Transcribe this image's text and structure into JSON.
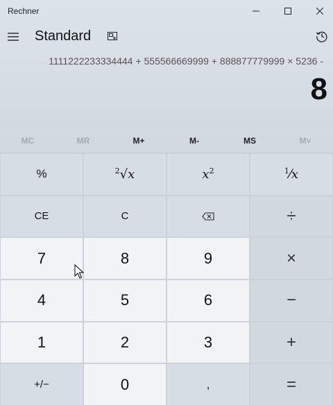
{
  "window": {
    "title": "Rechner"
  },
  "header": {
    "mode_title": "Standard"
  },
  "display": {
    "expression": "1111222233334444 + 555566669999 + 888877779999 × 5236 -",
    "result": "8"
  },
  "memory": {
    "buttons": [
      {
        "label": "MC",
        "enabled": false
      },
      {
        "label": "MR",
        "enabled": false
      },
      {
        "label": "M+",
        "enabled": true
      },
      {
        "label": "M-",
        "enabled": true
      },
      {
        "label": "MS",
        "enabled": true
      },
      {
        "label": "M˅",
        "enabled": false
      }
    ]
  },
  "keys": {
    "percent": "%",
    "sqrt_index": "2",
    "sqrt_symbol": "√",
    "sqrt_var": "x",
    "square_var": "x",
    "square_exp": "2",
    "reciprocal_num": "1",
    "reciprocal_var": "x",
    "ce": "CE",
    "c": "C",
    "divide": "÷",
    "d7": "7",
    "d8": "8",
    "d9": "9",
    "multiply": "×",
    "d4": "4",
    "d5": "5",
    "d6": "6",
    "minus": "−",
    "d1": "1",
    "d2": "2",
    "d3": "3",
    "plus": "+",
    "negate": "+/−",
    "d0": "0",
    "decimal": ",",
    "equals": "="
  },
  "icons": {
    "hamburger": "hamburger-icon",
    "keep_on_top": "keep-on-top-icon",
    "history": "history-icon",
    "backspace": "backspace-icon",
    "minimize": "minimize-icon",
    "maximize": "maximize-icon",
    "close": "close-icon"
  }
}
